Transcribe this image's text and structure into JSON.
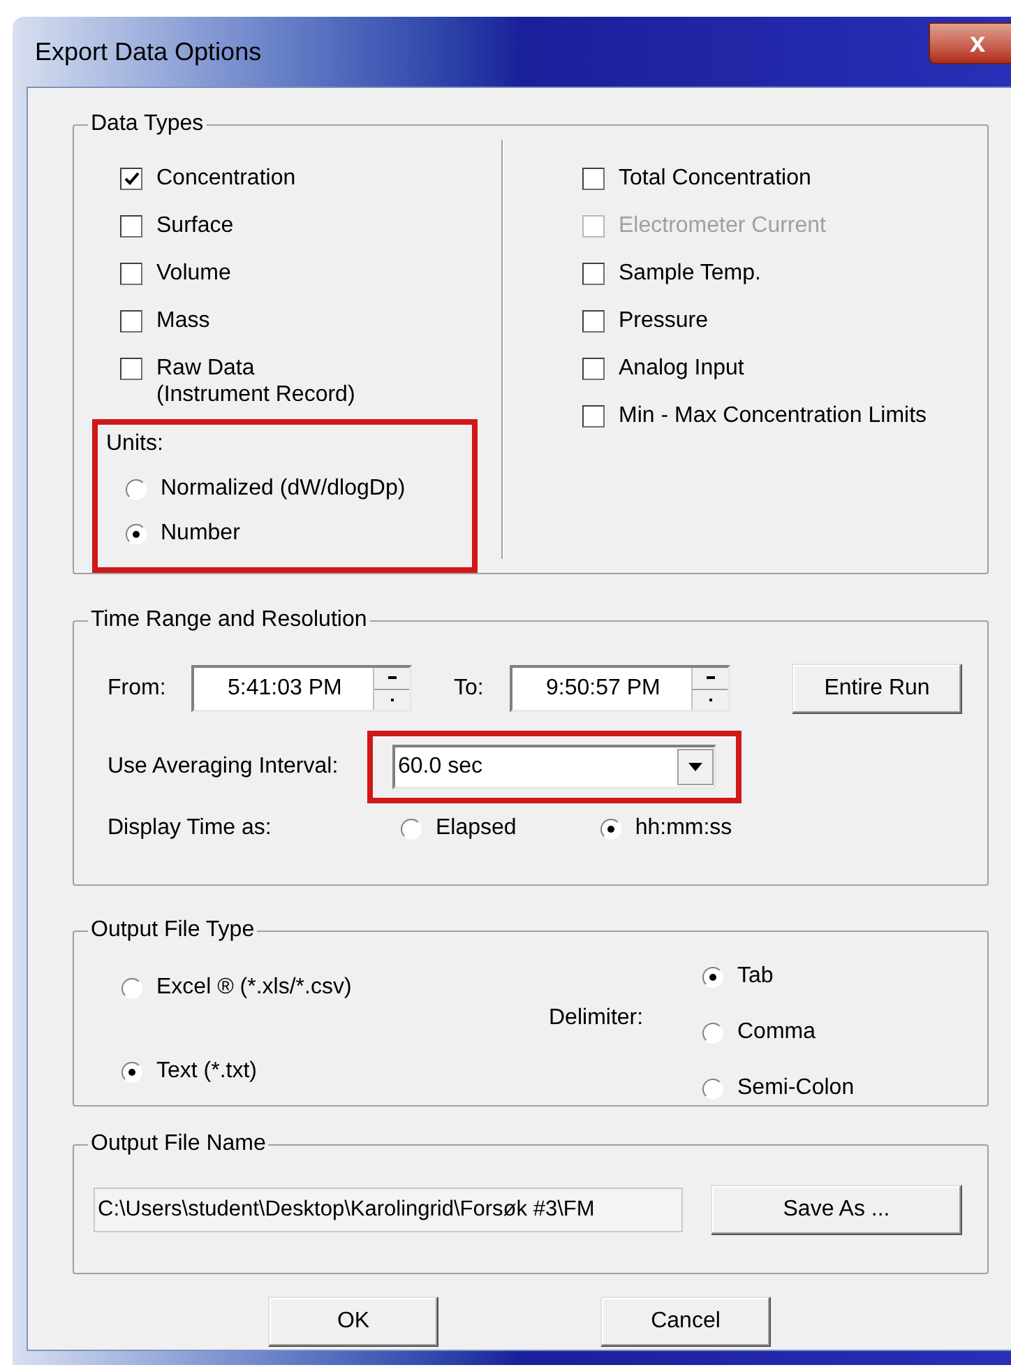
{
  "window": {
    "title": "Export Data Options",
    "close_button": "x"
  },
  "data_types": {
    "title": "Data Types",
    "left": [
      {
        "label": "Concentration",
        "checked": true,
        "disabled": false
      },
      {
        "label": "Surface",
        "checked": false,
        "disabled": false
      },
      {
        "label": "Volume",
        "checked": false,
        "disabled": false
      },
      {
        "label": "Mass",
        "checked": false,
        "disabled": false
      },
      {
        "label": "Raw Data\n(Instrument Record)",
        "checked": false,
        "disabled": false
      }
    ],
    "right": [
      {
        "label": "Total Concentration",
        "checked": false,
        "disabled": false
      },
      {
        "label": "Electrometer Current",
        "checked": false,
        "disabled": true
      },
      {
        "label": "Sample Temp.",
        "checked": false,
        "disabled": false
      },
      {
        "label": "Pressure",
        "checked": false,
        "disabled": false
      },
      {
        "label": "Analog Input",
        "checked": false,
        "disabled": false
      },
      {
        "label": "Min - Max  Concentration  Limits",
        "checked": false,
        "disabled": false
      }
    ],
    "units": {
      "title": "Units:",
      "highlighted": true,
      "options": [
        {
          "label": "Normalized (dW/dlogDp)",
          "selected": false
        },
        {
          "label": "Number",
          "selected": true
        }
      ]
    }
  },
  "time_range": {
    "title": "Time Range and Resolution",
    "from": {
      "label": "From:",
      "value": "5:41:03 PM"
    },
    "to": {
      "label": "To:",
      "value": "9:50:57 PM"
    },
    "entire_run_button": "Entire Run",
    "averaging": {
      "label": "Use Averaging Interval:",
      "value": "60.0 sec",
      "highlighted": true
    },
    "display_time": {
      "label": "Display Time as:",
      "options": [
        {
          "label": "Elapsed",
          "selected": false
        },
        {
          "label": "hh:mm:ss",
          "selected": true
        }
      ]
    }
  },
  "output_file_type": {
    "title": "Output File Type",
    "types": [
      {
        "label": "Excel ® (*.xls/*.csv)",
        "selected": false
      },
      {
        "label": "Text  (*.txt)",
        "selected": true
      }
    ],
    "delimiter": {
      "label": "Delimiter:",
      "options": [
        {
          "label": "Tab",
          "selected": true
        },
        {
          "label": "Comma",
          "selected": false
        },
        {
          "label": "Semi-Colon",
          "selected": false
        }
      ]
    }
  },
  "output_file_name": {
    "title": "Output File Name",
    "value": "C:\\Users\\student\\Desktop\\Karolingrid\\Forsøk #3\\FM",
    "save_as_button": "Save As ..."
  },
  "buttons": [
    "OK",
    "Cancel"
  ]
}
